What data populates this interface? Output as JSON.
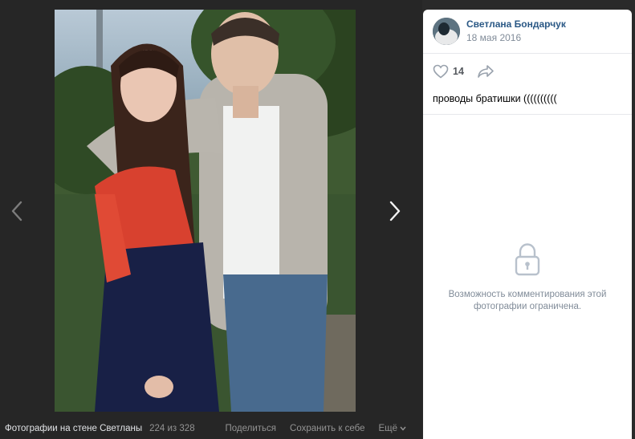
{
  "viewer": {
    "album_title": "Фотографии на стене Светланы",
    "counter": "224 из 328",
    "share_label": "Поделиться",
    "save_label": "Сохранить к себе",
    "more_label": "Ещё"
  },
  "post": {
    "author_name": "Светлана Бондарчук",
    "date": "18 мая 2016",
    "like_count": "14",
    "caption": "проводы братишки ((((((((((",
    "comments_locked_text": "Возможность комментирования этой фотографии ограничена."
  },
  "icons": {
    "prev": "chevron-left-icon",
    "next": "chevron-right-icon",
    "like": "heart-icon",
    "share": "share-arrow-icon",
    "lock": "lock-icon",
    "more": "chevron-down-icon"
  },
  "colors": {
    "viewer_bg": "#262626",
    "author_link": "#2a5885",
    "muted_text": "#818c99",
    "panel_bg": "#ffffff"
  }
}
